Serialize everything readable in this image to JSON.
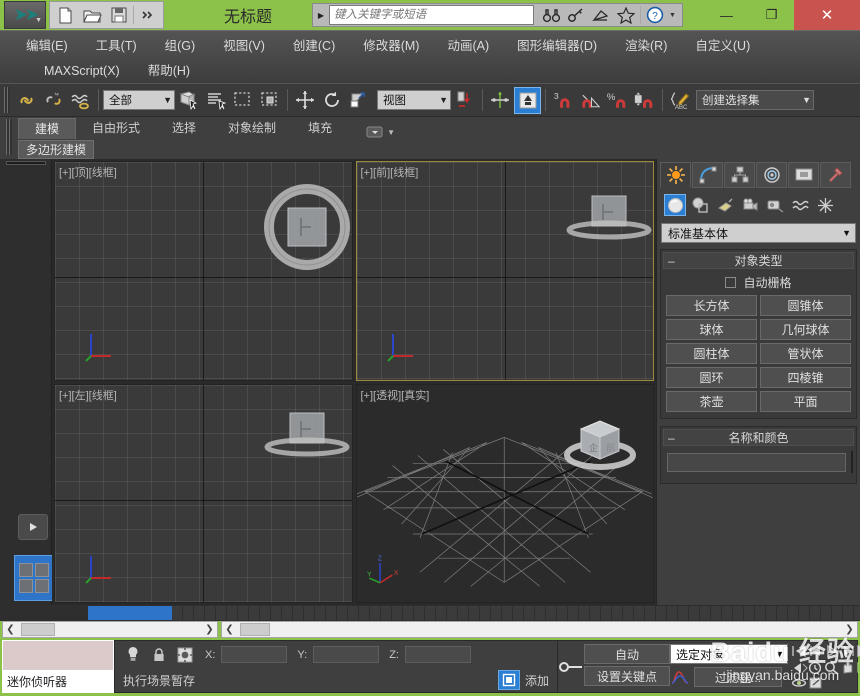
{
  "titlebar": {
    "app_icon": "3dsmax-logo-icon",
    "document_title": "无标题",
    "quick_access": [
      {
        "name": "new-file-button",
        "icon": "new-file-icon",
        "label": "新建"
      },
      {
        "name": "open-file-button",
        "icon": "open-folder-icon",
        "label": "打开"
      },
      {
        "name": "save-file-button",
        "icon": "save-disk-icon",
        "label": "保存"
      },
      {
        "name": "qat-more-button",
        "icon": "double-chevron-icon",
        "label": "更多"
      }
    ],
    "search": {
      "placeholder": "键入关键字或短语",
      "value": ""
    },
    "tools": [
      {
        "name": "binoculars-button",
        "icon": "binoculars-icon"
      },
      {
        "name": "key-button",
        "icon": "key-icon"
      },
      {
        "name": "dish-button",
        "icon": "satellite-dish-icon"
      },
      {
        "name": "favorites-button",
        "icon": "star-icon"
      },
      {
        "name": "help-button",
        "icon": "question-circle-icon"
      }
    ],
    "window_buttons": {
      "minimize": "—",
      "maximize": "❐",
      "close": "✕"
    }
  },
  "menubar": {
    "row1": [
      {
        "label": "编辑(E)",
        "key": "E"
      },
      {
        "label": "工具(T)",
        "key": "T"
      },
      {
        "label": "组(G)",
        "key": "G"
      },
      {
        "label": "视图(V)",
        "key": "V"
      },
      {
        "label": "创建(C)",
        "key": "C"
      },
      {
        "label": "修改器(M)",
        "key": "M"
      },
      {
        "label": "动画(A)",
        "key": "A"
      },
      {
        "label": "图形编辑器(D)",
        "key": "D"
      },
      {
        "label": "渲染(R)",
        "key": "R"
      },
      {
        "label": "自定义(U)",
        "key": "U"
      }
    ],
    "row2": [
      {
        "label": "MAXScript(X)",
        "key": "X"
      },
      {
        "label": "帮助(H)",
        "key": "H"
      }
    ]
  },
  "maintoolbar": {
    "selection_filter": "全部",
    "reference_coord": "视图",
    "named_selection_set": "创建选择集",
    "snap_percent_label": "%",
    "snap_three_label": "3",
    "buttons": [
      {
        "name": "select-link-button",
        "icon": "link-icon"
      },
      {
        "name": "unlink-selection-button",
        "icon": "unlink-icon"
      },
      {
        "name": "bind-to-space-warp-button",
        "icon": "space-warp-icon"
      },
      {
        "name": "select-object-button",
        "icon": "select-cursor-icon"
      },
      {
        "name": "select-by-name-button",
        "icon": "select-by-name-icon"
      },
      {
        "name": "rectangular-selection-region-button",
        "icon": "rectangle-marquee-icon"
      },
      {
        "name": "window-crossing-button",
        "icon": "window-crossing-icon"
      },
      {
        "name": "select-and-move-button",
        "icon": "move-arrows-icon"
      },
      {
        "name": "select-and-rotate-button",
        "icon": "rotate-arrow-icon"
      },
      {
        "name": "select-and-scale-button",
        "icon": "scale-icon"
      },
      {
        "name": "use-pivot-center-button",
        "icon": "pivot-center-icon"
      },
      {
        "name": "mirror-button",
        "icon": "mirror-icon"
      },
      {
        "name": "align-button",
        "icon": "align-up-icon"
      },
      {
        "name": "snap-toggle-button",
        "icon": "snap-magnet-icon"
      },
      {
        "name": "angle-snap-button",
        "icon": "angle-snap-icon"
      },
      {
        "name": "percent-snap-button",
        "icon": "percent-snap-icon"
      },
      {
        "name": "spinner-snap-button",
        "icon": "spinner-snap-icon"
      },
      {
        "name": "edit-named-selection-button",
        "icon": "abc-pencil-icon"
      }
    ]
  },
  "ribbon": {
    "tabs": [
      {
        "label": "建模",
        "active": true
      },
      {
        "label": "自由形式",
        "active": false
      },
      {
        "label": "选择",
        "active": false
      },
      {
        "label": "对象绘制",
        "active": false
      },
      {
        "label": "填充",
        "active": false
      }
    ],
    "dropdown_icon": "ribbon-dropdown-icon",
    "panel_button": "多边形建模"
  },
  "leftrail": {
    "expand_button_icon": "play-triangle-icon",
    "layout_button_icon": "four-viewport-layout-icon"
  },
  "viewports": [
    {
      "name": "viewport-top",
      "label": "[+][顶][线框]",
      "active": false,
      "shading": "wireframe"
    },
    {
      "name": "viewport-front",
      "label": "[+][前][线框]",
      "active": true,
      "shading": "wireframe"
    },
    {
      "name": "viewport-left",
      "label": "[+][左][线框]",
      "active": false,
      "shading": "wireframe"
    },
    {
      "name": "viewport-perspective",
      "label": "[+][透视][真实]",
      "active": false,
      "shading": "realistic"
    }
  ],
  "axis_labels": {
    "x": "X",
    "y": "Y",
    "z": "Z"
  },
  "command_panel": {
    "tabs": [
      {
        "name": "create-tab",
        "icon": "star-burst-icon",
        "active": true
      },
      {
        "name": "modify-tab",
        "icon": "curve-arc-icon",
        "active": false
      },
      {
        "name": "hierarchy-tab",
        "icon": "hierarchy-icon",
        "active": false
      },
      {
        "name": "motion-tab",
        "icon": "motion-wheel-icon",
        "active": false
      },
      {
        "name": "display-tab",
        "icon": "display-monitor-icon",
        "active": false
      },
      {
        "name": "utilities-tab",
        "icon": "hammer-icon",
        "active": false
      }
    ],
    "category_buttons": [
      {
        "name": "geometry-button",
        "icon": "sphere-icon",
        "active": true
      },
      {
        "name": "shapes-button",
        "icon": "shapes-icon",
        "active": false
      },
      {
        "name": "lights-button",
        "icon": "light-icon",
        "active": false
      },
      {
        "name": "cameras-button",
        "icon": "camera-icon",
        "active": false
      },
      {
        "name": "helpers-button",
        "icon": "tape-helper-icon",
        "active": false
      },
      {
        "name": "space-warps-button",
        "icon": "wave-icon",
        "active": false
      },
      {
        "name": "systems-button",
        "icon": "systems-icon",
        "active": false
      }
    ],
    "category_dropdown": "标准基本体",
    "object_type": {
      "title": "对象类型",
      "autogrid_label": "自动栅格",
      "autogrid_checked": false,
      "buttons": [
        "长方体",
        "圆锥体",
        "球体",
        "几何球体",
        "圆柱体",
        "管状体",
        "圆环",
        "四棱锥",
        "茶壶",
        "平面"
      ]
    },
    "name_and_color": {
      "title": "名称和颜色",
      "name_value": "",
      "color": "#cc3388"
    }
  },
  "statusbar": {
    "mini_listener_label": "迷你侦听器",
    "coordinates": {
      "x_label": "X:",
      "x_value": "",
      "y_label": "Y:",
      "y_value": "",
      "z_label": "Z:",
      "z_value": ""
    },
    "prompt_text": "执行场景暂存",
    "add_timetag_label": "添加",
    "icons": [
      {
        "name": "prompt-bulb-icon"
      },
      {
        "name": "selection-lock-icon"
      },
      {
        "name": "absolute-relative-mode-icon"
      },
      {
        "name": "add-time-tag-icon"
      },
      {
        "name": "set-key-icon"
      }
    ],
    "animation": {
      "auto_key_label": "自动",
      "set_key_label": "设置关键点",
      "curve_editor_icon": "curve-editor-icon"
    },
    "selection": {
      "selected_object_label": "选定对象",
      "filter_label": "过滤器..."
    },
    "navigation_buttons": [
      {
        "name": "goto-start-button",
        "icon": "skip-start-icon"
      },
      {
        "name": "previous-frame-button",
        "icon": "step-back-icon"
      },
      {
        "name": "play-animation-button",
        "icon": "play-icon"
      },
      {
        "name": "next-frame-button",
        "icon": "step-forward-icon"
      },
      {
        "name": "goto-end-button",
        "icon": "skip-end-icon"
      },
      {
        "name": "key-mode-toggle-button",
        "icon": "key-mode-icon"
      },
      {
        "name": "time-configuration-button",
        "icon": "clock-icon"
      },
      {
        "name": "zoom-button",
        "icon": "magnifier-icon"
      },
      {
        "name": "pan-view-button",
        "icon": "hand-icon"
      },
      {
        "name": "zoom-extents-button",
        "icon": "zoom-extents-icon"
      },
      {
        "name": "orbit-button",
        "icon": "orbit-icon"
      },
      {
        "name": "maximize-viewport-button",
        "icon": "maximize-viewport-icon"
      }
    ]
  },
  "watermark": {
    "line1": "Baidu 经验",
    "line2": "jingyan.baidu.com"
  },
  "colors": {
    "window_frame": "#8dc24a",
    "close_button": "#c9544f",
    "accent_blue": "#2a7fd4",
    "active_viewport_border": "#9a8a3a",
    "object_color_swatch": "#cc3388"
  }
}
